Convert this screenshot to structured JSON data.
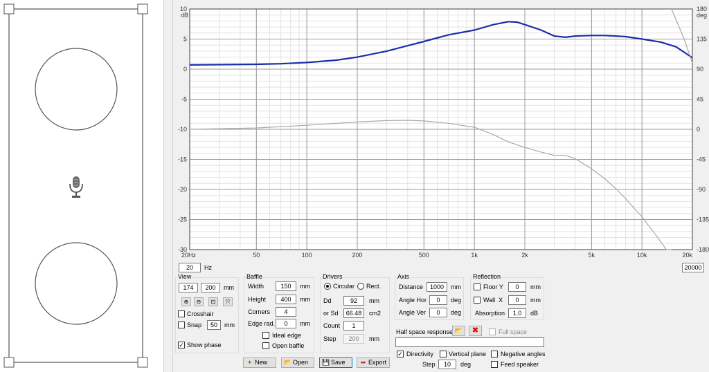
{
  "chart_data": {
    "type": "line",
    "xscale": "log",
    "xlim": [
      20,
      20000
    ],
    "ylim": [
      -30,
      10
    ],
    "y2lim": [
      -180,
      180
    ],
    "grid": true,
    "x_ticks": [
      {
        "v": 20,
        "label": "20Hz"
      },
      {
        "v": 50,
        "label": "50"
      },
      {
        "v": 100,
        "label": "100"
      },
      {
        "v": 200,
        "label": "200"
      },
      {
        "v": 500,
        "label": "500"
      },
      {
        "v": 1000,
        "label": "1k"
      },
      {
        "v": 2000,
        "label": "2k"
      },
      {
        "v": 5000,
        "label": "5k"
      },
      {
        "v": 10000,
        "label": "10k"
      },
      {
        "v": 20000,
        "label": "20k"
      }
    ],
    "y_ticks": [
      {
        "v": 10,
        "label": "10"
      },
      {
        "v": 5,
        "label": "5"
      },
      {
        "v": 0,
        "label": "0"
      },
      {
        "v": -5,
        "label": "-5"
      },
      {
        "v": -10,
        "label": "-10"
      },
      {
        "v": -15,
        "label": "-15"
      },
      {
        "v": -20,
        "label": "-20"
      },
      {
        "v": -25,
        "label": "-25"
      },
      {
        "v": -30,
        "label": "-30"
      }
    ],
    "y_unit": "dB",
    "y2_ticks": [
      {
        "v": 180,
        "label": "180"
      },
      {
        "v": 135,
        "label": "135"
      },
      {
        "v": 90,
        "label": "90"
      },
      {
        "v": 45,
        "label": "45"
      },
      {
        "v": 0,
        "label": "0"
      },
      {
        "v": -45,
        "label": "-45"
      },
      {
        "v": -90,
        "label": "-90"
      },
      {
        "v": -135,
        "label": "-135"
      },
      {
        "v": -180,
        "label": "-180"
      }
    ],
    "y2_unit": "deg",
    "series": [
      {
        "role": "magnitude",
        "axis": "left",
        "color": "#1a2fa8",
        "x": [
          20,
          30,
          50,
          70,
          100,
          150,
          200,
          300,
          400,
          500,
          700,
          1000,
          1300,
          1600,
          1800,
          2000,
          2500,
          3000,
          3500,
          4000,
          5000,
          6000,
          7000,
          8000,
          10000,
          13000,
          16000,
          20000
        ],
        "y": [
          0.7,
          0.75,
          0.8,
          0.9,
          1.1,
          1.5,
          2.0,
          3.0,
          3.9,
          4.6,
          5.7,
          6.5,
          7.4,
          7.9,
          7.8,
          7.4,
          6.5,
          5.5,
          5.3,
          5.5,
          5.6,
          5.6,
          5.5,
          5.4,
          5.0,
          4.5,
          3.7,
          1.9
        ]
      },
      {
        "role": "phase",
        "axis": "right",
        "color": "#a8a8a8",
        "x": [
          20,
          50,
          100,
          200,
          300,
          400,
          500,
          700,
          1000,
          1300,
          1600,
          2000,
          2500,
          3000,
          3500,
          4000,
          5000,
          6000,
          7000,
          8000,
          10000,
          12000,
          14000,
          15000,
          15000,
          16000,
          18000,
          20000
        ],
        "y": [
          0,
          2,
          6,
          11,
          13,
          13.5,
          12.5,
          9,
          3,
          -8,
          -19,
          -27,
          -34,
          -39,
          -39,
          -44,
          -59,
          -74,
          -89,
          -104,
          -131,
          -157,
          -180,
          -180,
          180,
          164,
          133,
          99
        ]
      }
    ]
  },
  "freq_min": "20",
  "freq_unit": "Hz",
  "freq_max": "20000",
  "view": {
    "title": "View",
    "w": "174",
    "h": "200",
    "unit": "mm",
    "crosshair": "Crosshair",
    "snap": "Snap",
    "snap_value": "50",
    "snap_unit": "mm",
    "show_phase": "Show phase",
    "zoom_icons": [
      "zoom-in-icon",
      "zoom-out-icon",
      "zoom-fit-icon",
      "zoom-extents-icon"
    ]
  },
  "baffle": {
    "title": "Baffle",
    "width_label": "Width",
    "width": "150",
    "width_unit": "mm",
    "height_label": "Height",
    "height": "400",
    "height_unit": "mm",
    "corners_label": "Corners",
    "corners": "4",
    "edge_label": "Edge rad.",
    "edge": "0",
    "edge_unit": "mm",
    "ideal_edge": "Ideal edge",
    "open_baffle": "Open baffle"
  },
  "drivers": {
    "title": "Drivers",
    "circular": "Circular",
    "rect": "Rect.",
    "dd_label": "Dd",
    "dd": "92",
    "dd_unit": "mm",
    "sd_label": "or Sd",
    "sd": "66.48",
    "sd_unit": "cm2",
    "count_label": "Count",
    "count": "1",
    "step_label": "Step",
    "step": "200",
    "step_unit": "mm"
  },
  "axis": {
    "title": "Axis",
    "distance_label": "Distance",
    "distance": "1000",
    "distance_unit": "mm",
    "hor_label": "Angle Hor",
    "hor": "0",
    "hor_unit": "deg",
    "ver_label": "Angle Ver",
    "ver": "0",
    "ver_unit": "deg"
  },
  "reflection": {
    "title": "Reflection",
    "floor_label": "Floor Y",
    "floor": "0",
    "floor_unit": "mm",
    "wall_label": "Wall  X",
    "wall": "0",
    "wall_unit": "mm",
    "absorption_label": "Absorption",
    "absorption": "1.0",
    "absorption_unit": "dB"
  },
  "half_space": {
    "label": "Half space response",
    "full_space": "Full space",
    "path": ""
  },
  "directivity": {
    "directivity": "Directivity",
    "vertical_plane": "Vertical plane",
    "negative_angles": "Negative angles",
    "feed_speaker": "Feed speaker",
    "step_label": "Step",
    "step": "10",
    "step_unit": "deg"
  },
  "buttons": {
    "new": "New",
    "open": "Open",
    "save": "Save",
    "export": "Export"
  }
}
